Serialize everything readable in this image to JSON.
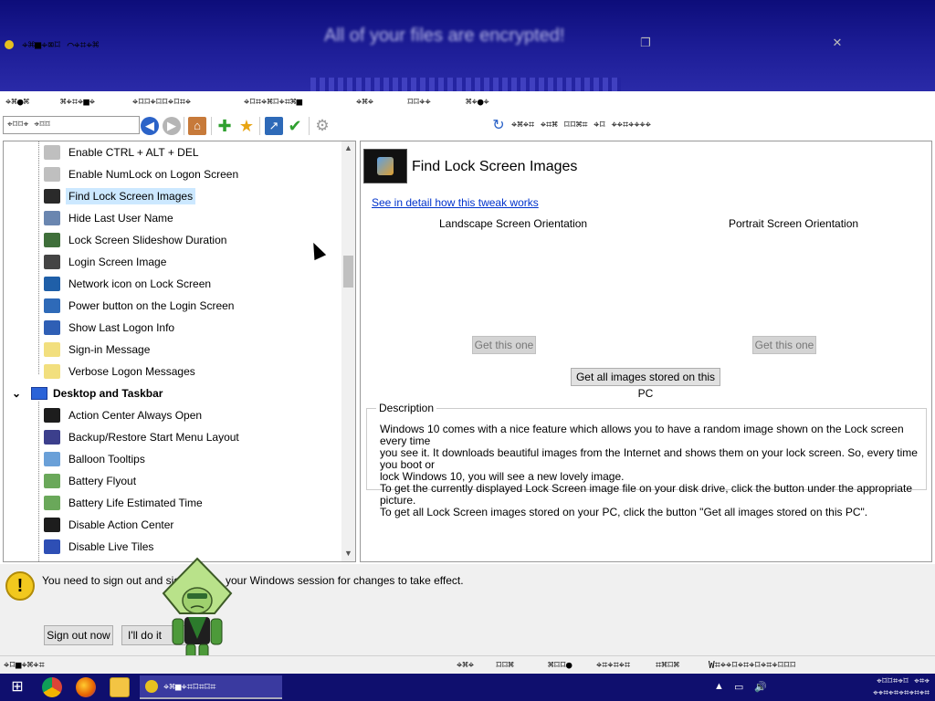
{
  "window": {
    "title": "⌖⌘■⌖⌧⌑ ⌒⌖⌗⌖⌘",
    "overlay_text": "All of your files are encrypted!"
  },
  "menu": [
    "⌖⌘●⌘",
    "⌘⌖⌗⌖■⌖",
    "⌖⌑⌑⌖⌑⌑⌖⌑⌗⌖",
    "⌖⌑⌗⌖⌘⌑⌖⌗⌘■",
    "⌖⌘⌖",
    "⌑⌑⌖⌖",
    "⌘⌖●⌖"
  ],
  "toolbar": {
    "search_placeholder": "⌖⌑⌑⌖ ⌖⌑⌑",
    "right_link": "⌖⌘⌖⌗ ⌖⌗⌘ ⌑⌑⌘⌗ ⌖⌑ ⌖⌖⌗⌖⌖⌖⌖"
  },
  "tree": {
    "items": [
      {
        "label": "Enable CTRL + ALT + DEL",
        "icon": "keyboard-icon",
        "color": "#bfbfbf"
      },
      {
        "label": "Enable NumLock on Logon Screen",
        "icon": "keyboard-icon",
        "color": "#bfbfbf"
      },
      {
        "label": "Find Lock Screen Images",
        "icon": "picture-icon",
        "color": "#2a2a2a",
        "selected": true
      },
      {
        "label": "Hide Last User Name",
        "icon": "user-icon",
        "color": "#6a86b0"
      },
      {
        "label": "Lock Screen Slideshow Duration",
        "icon": "slideshow-icon",
        "color": "#3f6f3a"
      },
      {
        "label": "Login Screen Image",
        "icon": "account-icon",
        "color": "#444"
      },
      {
        "label": "Network icon on Lock Screen",
        "icon": "network-icon",
        "color": "#1f5fa8"
      },
      {
        "label": "Power button on the Login Screen",
        "icon": "power-icon",
        "color": "#2e6ab8"
      },
      {
        "label": "Show Last Logon Info",
        "icon": "help-icon",
        "color": "#2f5fb5"
      },
      {
        "label": "Sign-in Message",
        "icon": "message-icon",
        "color": "#f2df7e"
      },
      {
        "label": "Verbose Logon Messages",
        "icon": "message-icon",
        "color": "#f2df7e"
      }
    ],
    "category": "Desktop and Taskbar",
    "category_items": [
      {
        "label": "Action Center Always Open",
        "icon": "action-center-icon",
        "color": "#1d1d1d"
      },
      {
        "label": "Backup/Restore Start Menu Layout",
        "icon": "start-menu-icon",
        "color": "#3c3f8c"
      },
      {
        "label": "Balloon Tooltips",
        "icon": "info-icon",
        "color": "#6aa0d8"
      },
      {
        "label": "Battery Flyout",
        "icon": "watering-can-icon",
        "color": "#6aa85a"
      },
      {
        "label": "Battery Life Estimated Time",
        "icon": "watering-can-icon",
        "color": "#6aa85a"
      },
      {
        "label": "Disable Action Center",
        "icon": "action-center-icon",
        "color": "#1d1d1d"
      },
      {
        "label": "Disable Live Tiles",
        "icon": "tiles-icon",
        "color": "#2e4fb5"
      }
    ]
  },
  "main": {
    "title": "Find Lock Screen Images",
    "detail_link": "See in detail how this tweak works",
    "landscape_label": "Landscape Screen Orientation",
    "portrait_label": "Portrait Screen Orientation",
    "get_this_one_1": "Get this one",
    "get_this_one_2": "Get this one",
    "get_all": "Get all images stored on this PC",
    "description_legend": "Description",
    "description_lines": [
      "Windows 10 comes with a nice feature which allows you to have a random image shown on the Lock screen every time",
      "you see it. It downloads beautiful images from the Internet and shows them on your lock screen. So, every time you boot or",
      "lock Windows 10, you will see a new lovely image.",
      "To get the currently displayed Lock Screen image file on your disk drive, click the button under the appropriate picture.",
      "To get all Lock Screen images stored on your PC, click the button \"Get all images stored on this PC\"."
    ]
  },
  "notice": {
    "text_start": "You need to sign out and sig",
    "text_end": "your Windows session for changes to take effect.",
    "sign_out": "Sign out now",
    "later": "I'll do it myse"
  },
  "statusbar": {
    "left": "⌖⌑■⌖⌘⌖⌗",
    "right_1": "⌖⌘⌖",
    "right_2": "⌑⌑⌘",
    "right_3": "⌘⌑⌑●",
    "right_4": "⌖⌗⌖⌗⌖⌗",
    "right_5": "⌗⌘⌑⌘",
    "right_6": "W⌗⌖⌖⌑⌖⌗⌖⌑⌖⌗⌖⌑⌑⌑"
  },
  "taskbar": {
    "active_app": "⌖⌘■⌖⌗⌑⌗⌑⌗",
    "clock_line1": "⌖⌑⌑⌗⌖⌑ ⌖⌗⌖",
    "clock_line2": "⌖⌖⌗⌖⌗⌖⌗⌖⌗⌖⌗"
  }
}
